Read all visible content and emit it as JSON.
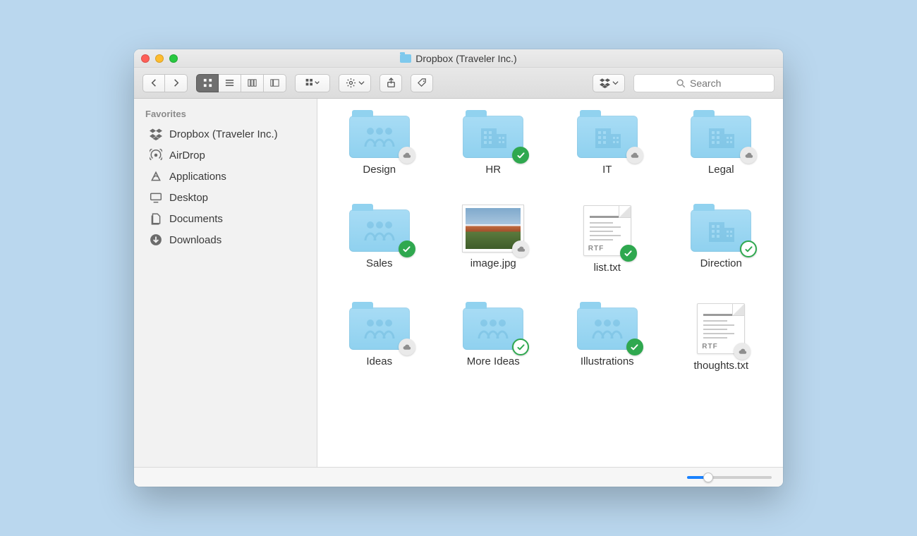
{
  "window": {
    "title": "Dropbox (Traveler Inc.)"
  },
  "toolbar": {
    "search_placeholder": "Search"
  },
  "sidebar": {
    "heading": "Favorites",
    "items": [
      {
        "label": "Dropbox (Traveler Inc.)",
        "icon": "dropbox-icon"
      },
      {
        "label": "AirDrop",
        "icon": "airdrop-icon"
      },
      {
        "label": "Applications",
        "icon": "applications-icon"
      },
      {
        "label": "Desktop",
        "icon": "desktop-icon"
      },
      {
        "label": "Documents",
        "icon": "documents-icon"
      },
      {
        "label": "Downloads",
        "icon": "downloads-icon"
      }
    ]
  },
  "items": [
    {
      "name": "Design",
      "kind": "folder",
      "variant": "people",
      "status": "cloud"
    },
    {
      "name": "HR",
      "kind": "folder",
      "variant": "building",
      "status": "synced-green"
    },
    {
      "name": "IT",
      "kind": "folder",
      "variant": "building",
      "status": "cloud"
    },
    {
      "name": "Legal",
      "kind": "folder",
      "variant": "building",
      "status": "cloud"
    },
    {
      "name": "Sales",
      "kind": "folder",
      "variant": "people",
      "status": "synced-green"
    },
    {
      "name": "image.jpg",
      "kind": "image",
      "status": "cloud"
    },
    {
      "name": "list.txt",
      "kind": "rtf",
      "status": "synced-green"
    },
    {
      "name": "Direction",
      "kind": "folder",
      "variant": "building",
      "status": "synced-outline"
    },
    {
      "name": "Ideas",
      "kind": "folder",
      "variant": "people",
      "status": "cloud"
    },
    {
      "name": "More Ideas",
      "kind": "folder",
      "variant": "people",
      "status": "synced-outline"
    },
    {
      "name": "Illustrations",
      "kind": "folder",
      "variant": "people",
      "status": "synced-green"
    },
    {
      "name": "thoughts.txt",
      "kind": "rtf",
      "status": "cloud"
    }
  ],
  "doc_ext": "RTF"
}
